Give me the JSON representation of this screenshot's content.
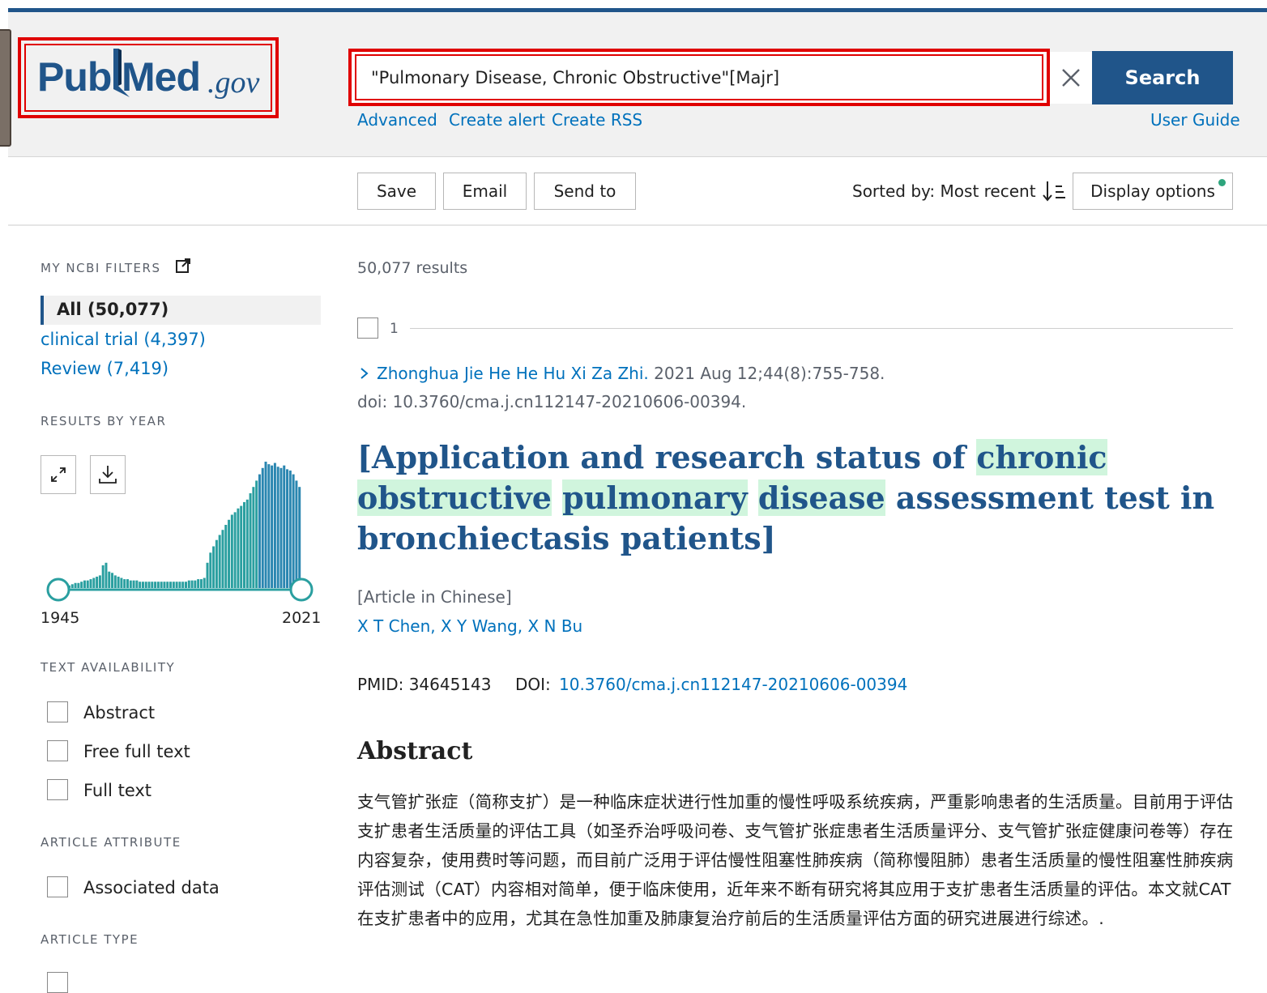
{
  "header": {
    "logo": {
      "pub": "Pub",
      "med": "Med",
      "gov": ".gov"
    },
    "search": {
      "value": "\"Pulmonary Disease, Chronic Obstructive\"[Majr]",
      "button_label": "Search"
    },
    "links": {
      "advanced": "Advanced",
      "create_alert": "Create alert",
      "create_rss": "Create RSS",
      "user_guide": "User Guide"
    }
  },
  "toolbar": {
    "save": "Save",
    "email": "Email",
    "send_to": "Send to",
    "sorted_by": "Sorted by: Most recent",
    "display_options": "Display options"
  },
  "sidebar": {
    "my_ncbi_filters": "MY NCBI FILTERS",
    "filters": [
      {
        "label": "All (50,077)"
      },
      {
        "label": "clinical trial (4,397)"
      },
      {
        "label": "Review (7,419)"
      }
    ],
    "results_by_year": "RESULTS BY YEAR",
    "year_start": "1945",
    "year_end": "2021",
    "year_histogram": [
      0.02,
      0.03,
      0.04,
      0.04,
      0.05,
      0.06,
      0.06,
      0.07,
      0.08,
      0.09,
      0.1,
      0.18,
      0.2,
      0.13,
      0.12,
      0.1,
      0.09,
      0.08,
      0.07,
      0.07,
      0.06,
      0.06,
      0.06,
      0.05,
      0.05,
      0.05,
      0.05,
      0.05,
      0.05,
      0.05,
      0.05,
      0.05,
      0.05,
      0.05,
      0.05,
      0.05,
      0.05,
      0.05,
      0.05,
      0.06,
      0.06,
      0.06,
      0.07,
      0.07,
      0.08,
      0.2,
      0.28,
      0.33,
      0.38,
      0.42,
      0.46,
      0.5,
      0.54,
      0.58,
      0.6,
      0.63,
      0.65,
      0.68,
      0.7,
      0.75,
      0.8,
      0.85,
      0.9,
      0.95,
      1.0,
      0.98,
      0.97,
      0.99,
      0.96,
      0.95,
      0.97,
      0.94,
      0.93,
      0.9,
      0.85,
      0.8
    ],
    "text_availability": "TEXT AVAILABILITY",
    "text_options": [
      "Abstract",
      "Free full text",
      "Full text"
    ],
    "article_attribute": "ARTICLE ATTRIBUTE",
    "attribute_options": [
      "Associated data"
    ],
    "article_type": "ARTICLE TYPE"
  },
  "results": {
    "count": "50,077 results",
    "index": "1",
    "journal": "Zhonghua Jie He He Hu Xi Za Zhi.",
    "citation": " 2021 Aug 12;44(8):755-758.",
    "doi_line": "doi: 10.3760/cma.j.cn112147-20210606-00394.",
    "title_parts": {
      "p1": "[Application and research status of ",
      "h1": "chronic",
      "h2": "obstructive",
      "h3": "pulmonary",
      "h4": "disease",
      "p2": " assessment test in bronchiectasis patients]"
    },
    "language": "[Article in Chinese]",
    "authors": "X T Chen, X Y Wang, X N Bu",
    "pmid": "PMID: 34645143",
    "doi_label": "DOI: ",
    "doi_link": "10.3760/cma.j.cn112147-20210606-00394",
    "abstract_heading": "Abstract",
    "abstract_text": "支气管扩张症（简称支扩）是一种临床症状进行性加重的慢性呼吸系统疾病，严重影响患者的生活质量。目前用于评估支扩患者生活质量的评估工具（如圣乔治呼吸问卷、支气管扩张症患者生活质量评分、支气管扩张症健康问卷等）存在内容复杂，使用费时等问题，而目前广泛用于评估慢性阻塞性肺疾病（简称慢阻肺）患者生活质量的慢性阻塞性肺疾病评估测试（CAT）内容相对简单，便于临床使用，近年来不断有研究将其应用于支扩患者生活质量的评估。本文就CAT在支扩患者中的应用，尤其在急性加重及肺康复治疗前后的生活质量评估方面的研究进展进行综述。."
  },
  "colors": {
    "brand": "#20558a",
    "link": "#0071bc",
    "highlight": "#d0f5dd",
    "annotation": "#e00000",
    "histogram": "#2a9fa0"
  }
}
